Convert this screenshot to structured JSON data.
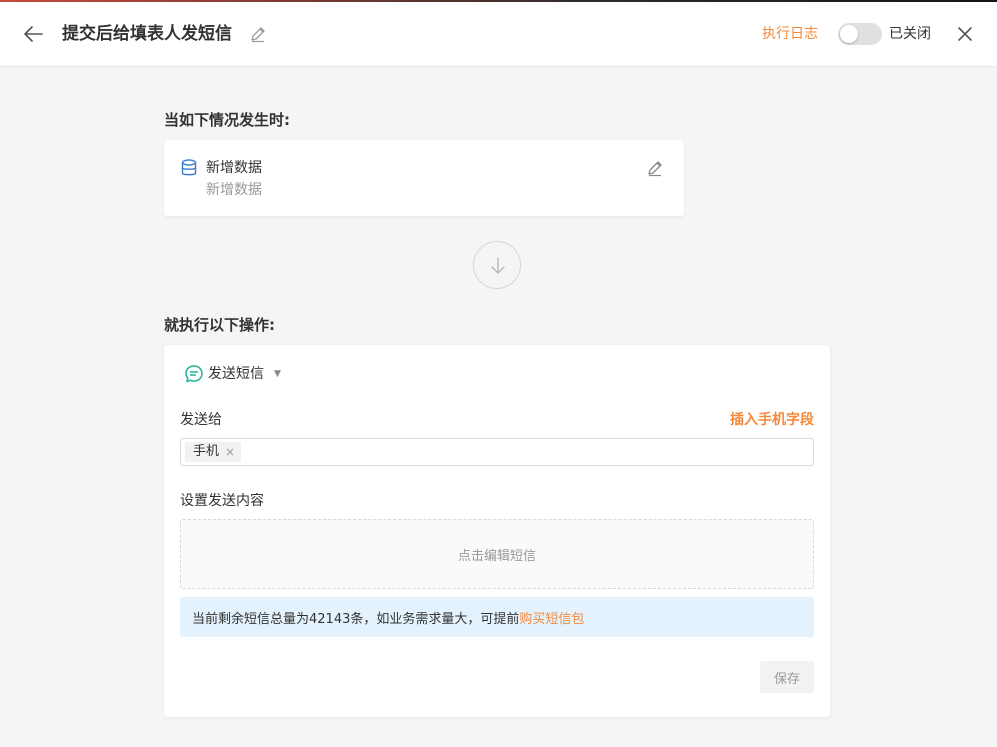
{
  "header": {
    "title": "提交后给填表人发短信",
    "log_link": "执行日志",
    "toggle_label": "已关闭"
  },
  "trigger": {
    "heading": "当如下情况发生时:",
    "card_title": "新增数据",
    "card_subtitle": "新增数据"
  },
  "action": {
    "heading": "就执行以下操作:",
    "type_label": "发送短信",
    "send_to_label": "发送给",
    "insert_field_link": "插入手机字段",
    "recipient_tag": "手机",
    "tag_remove": "×",
    "content_label": "设置发送内容",
    "content_placeholder": "点击编辑短信",
    "notice_text": "当前剩余短信总量为42143条，如业务需求量大，可提前",
    "notice_link": "购买短信包",
    "save_button": "保存"
  },
  "colors": {
    "accent_orange": "#f5893b",
    "notice_bg": "#e3f2fc",
    "db_icon": "#3a7bd5",
    "sms_icon": "#1ab394"
  }
}
